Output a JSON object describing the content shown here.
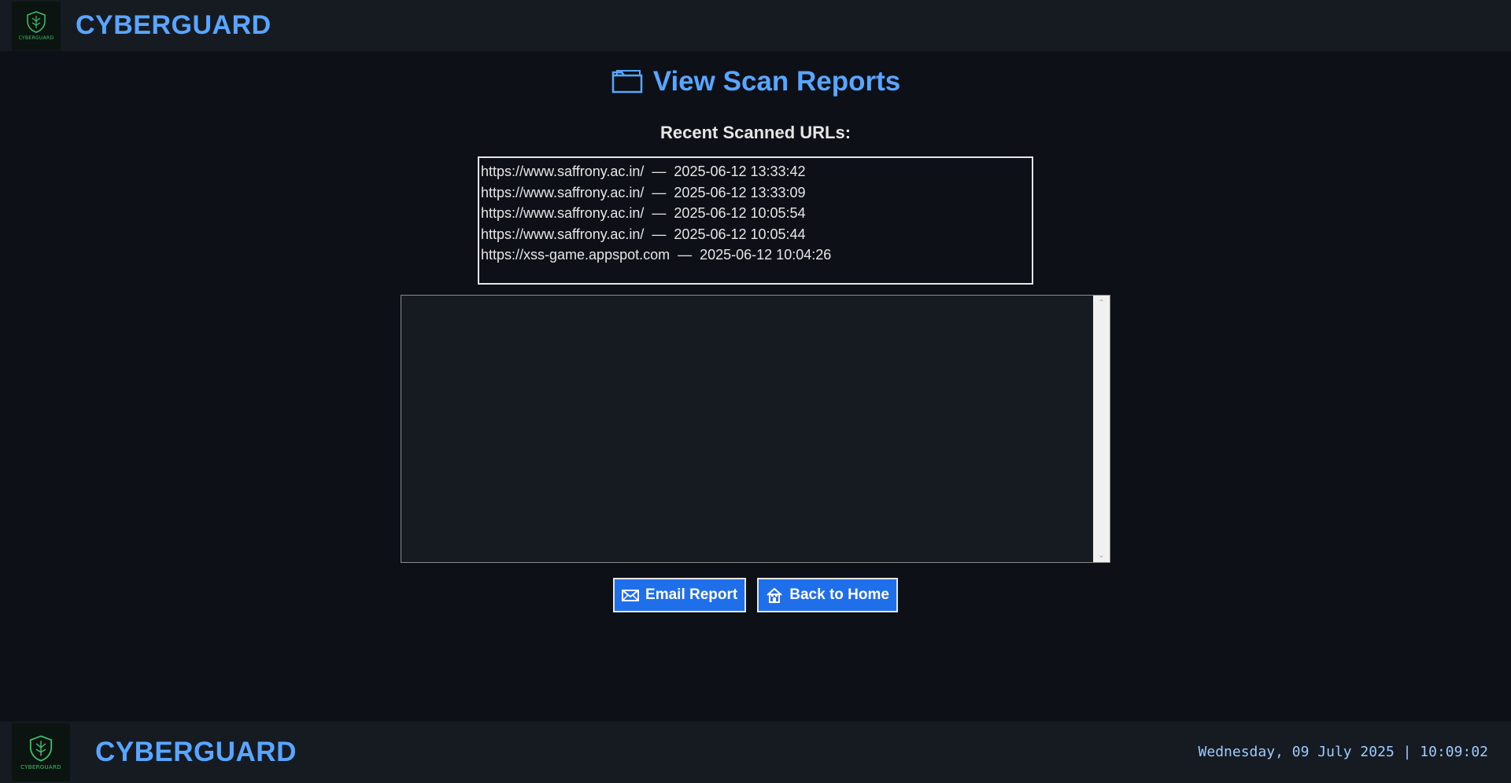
{
  "header": {
    "logo_text": "CYBERGUARD",
    "brand": "CYBERGUARD"
  },
  "page": {
    "title": "View Scan Reports",
    "subtitle": "Recent Scanned URLs:",
    "title_icon": "folder-icon"
  },
  "scans": [
    {
      "url": "https://www.saffrony.ac.in/",
      "sep": "—",
      "time": "2025-06-12 13:33:42"
    },
    {
      "url": "https://www.saffrony.ac.in/",
      "sep": "—",
      "time": "2025-06-12 13:33:09"
    },
    {
      "url": "https://www.saffrony.ac.in/",
      "sep": "—",
      "time": "2025-06-12 10:05:54"
    },
    {
      "url": "https://www.saffrony.ac.in/",
      "sep": "—",
      "time": "2025-06-12 10:05:44"
    },
    {
      "url": "https://xss-game.appspot.com",
      "sep": "—",
      "time": "2025-06-12 10:04:26"
    }
  ],
  "report": {
    "content": ""
  },
  "buttons": {
    "email_label": "Email Report",
    "email_icon": "email-icon",
    "home_label": "Back to Home",
    "home_icon": "home-icon"
  },
  "footer": {
    "logo_text": "CYBERGUARD",
    "brand": "CYBERGUARD",
    "datetime": "Wednesday, 09 July 2025 | 10:09:02"
  },
  "colors": {
    "background": "#0d1117",
    "panel": "#161b22",
    "accent": "#58a6ff",
    "button": "#1f6feb",
    "logo_green": "#3fbf6a"
  }
}
